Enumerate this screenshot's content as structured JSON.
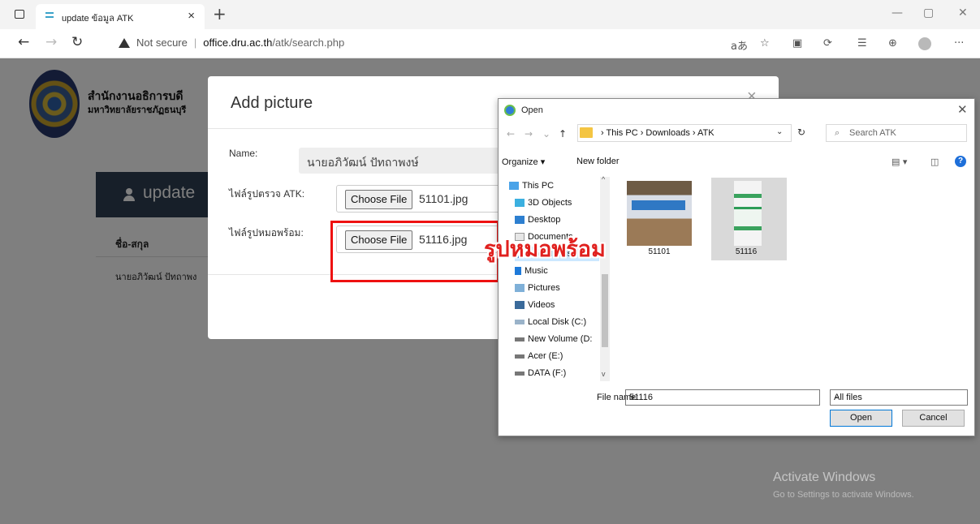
{
  "browser": {
    "tab_title": "update ข้อมูล ATK",
    "tab_close": "×",
    "new_tab": "+",
    "url_warning": "Not secure",
    "url_separator": "|",
    "url_host": "office.dru.ac.th",
    "url_path": "/atk/search.php",
    "read_aloud": "aあ",
    "more": "···"
  },
  "page": {
    "org_name": "สำนักงานอธิการบดี",
    "university": "มหาวิทยาลัยราชภัฏธนบุรี",
    "card_title": "update",
    "column_header": "ชื่อ-สกุล",
    "row_name": "นายอภิวัฒน์ ปัทถาพง"
  },
  "modal": {
    "title": "Add picture",
    "close": "×",
    "name_label": "Name:",
    "name_value": "นายอภิวัฒน์ ปัทถาพงษ์",
    "atk_label": "ไฟล์รูปตรวจ ATK:",
    "atk_button": "Choose File",
    "atk_file": "51101.jpg",
    "doctor_label": "ไฟล์รูปหมอพร้อม:",
    "doctor_button": "Choose File",
    "doctor_file": "51116.jpg"
  },
  "annotation": {
    "text": "รูปหมอพร้อม",
    "color": "#e0201e"
  },
  "file_dialog": {
    "title": "Open",
    "breadcrumb": "›  This PC  ›  Downloads  ›  ATK",
    "search_placeholder": "Search ATK",
    "organize": "Organize ▾",
    "new_folder": "New folder",
    "help": "?",
    "nav_items": [
      {
        "label": "This PC",
        "icon": "monitor-icon"
      },
      {
        "label": "3D Objects",
        "icon": "cube-icon"
      },
      {
        "label": "Desktop",
        "icon": "desktop-icon"
      },
      {
        "label": "Documents",
        "icon": "document-icon"
      },
      {
        "label": "Downloads",
        "icon": "download-icon"
      },
      {
        "label": "Music",
        "icon": "music-icon"
      },
      {
        "label": "Pictures",
        "icon": "pictures-icon"
      },
      {
        "label": "Videos",
        "icon": "video-icon"
      },
      {
        "label": "Local Disk (C:)",
        "icon": "drive-icon"
      },
      {
        "label": "New Volume (D:",
        "icon": "drive-icon"
      },
      {
        "label": "Acer (E:)",
        "icon": "drive-icon"
      },
      {
        "label": "DATA (F:)",
        "icon": "drive-icon"
      }
    ],
    "files": [
      {
        "name": "51101",
        "selected": false
      },
      {
        "name": "51116",
        "selected": true
      }
    ],
    "file_name_label": "File name:",
    "file_name_value": "51116",
    "file_type": "All files",
    "open_button": "Open",
    "cancel_button": "Cancel"
  },
  "watermark": {
    "title": "Activate Windows",
    "subtitle": "Go to Settings to activate Windows."
  }
}
